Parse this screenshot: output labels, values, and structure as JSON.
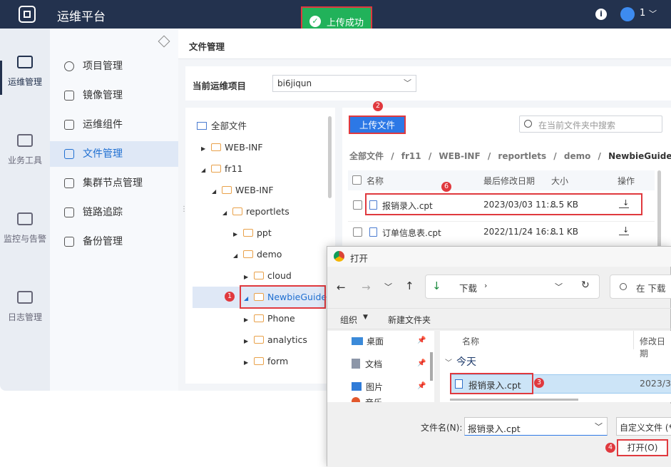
{
  "app": {
    "title": "运维平台",
    "user_badge": "1",
    "accent": "#2c78e6",
    "toast_color": "#21b25a",
    "highlight": "#e0393e"
  },
  "toast": {
    "text": "上传成功",
    "step": "5"
  },
  "rail": [
    {
      "label": "运维管理",
      "icon": "monitor-icon"
    },
    {
      "label": "业务工具",
      "icon": "code-icon"
    },
    {
      "label": "监控与告警",
      "icon": "pulse-icon"
    },
    {
      "label": "日志管理",
      "icon": "calendar-icon"
    }
  ],
  "menu": [
    {
      "label": "项目管理",
      "icon": "settings-icon"
    },
    {
      "label": "镜像管理",
      "icon": "mirror-icon"
    },
    {
      "label": "运维组件",
      "icon": "components-icon"
    },
    {
      "label": "文件管理",
      "icon": "file-icon"
    },
    {
      "label": "集群节点管理",
      "icon": "sliders-icon"
    },
    {
      "label": "链路追踪",
      "icon": "link-icon"
    },
    {
      "label": "备份管理",
      "icon": "backup-icon"
    }
  ],
  "main": {
    "title": "文件管理",
    "project_label": "当前运维项目",
    "project_value": "bi6jiqun",
    "upload_btn": "上传文件",
    "upload_step": "2",
    "search_placeholder": "在当前文件夹中搜索",
    "breadcrumb": [
      "全部文件",
      "fr11",
      "WEB-INF",
      "reportlets",
      "demo",
      "NewbieGuide"
    ],
    "breadcrumb_sep": "/",
    "columns": {
      "name": "名称",
      "modified": "最后修改日期",
      "size": "大小",
      "action": "操作"
    },
    "rows": [
      {
        "name": "报销录入.cpt",
        "modified": "2023/03/03 11:...",
        "size": "8.5 KB"
      },
      {
        "name": "订单信息表.cpt",
        "modified": "2022/11/24 16:...",
        "size": "8.1 KB"
      }
    ],
    "row_step": "6"
  },
  "tree": {
    "root": "全部文件",
    "nodes": [
      "WEB-INF",
      "fr11",
      "WEB-INF",
      "reportlets",
      "ppt",
      "demo",
      "cloud",
      "NewbieGuide",
      "Phone",
      "analytics",
      "form"
    ],
    "selected_step": "1"
  },
  "dialog": {
    "title": "打开",
    "location": "下载",
    "search_placeholder": "在 下载",
    "organize": "组织",
    "new_folder": "新建文件夹",
    "nav": [
      "桌面",
      "文档",
      "图片",
      "音乐"
    ],
    "col_name": "名称",
    "col_modified": "修改日期",
    "group": "今天",
    "file": "报销录入.cpt",
    "file_date": "2023/3/",
    "file_step": "3",
    "filename_label": "文件名(N):",
    "filename_value": "报销录入.cpt",
    "filter": "自定义文件 (*",
    "open_btn": "打开(O)",
    "open_step": "4"
  }
}
